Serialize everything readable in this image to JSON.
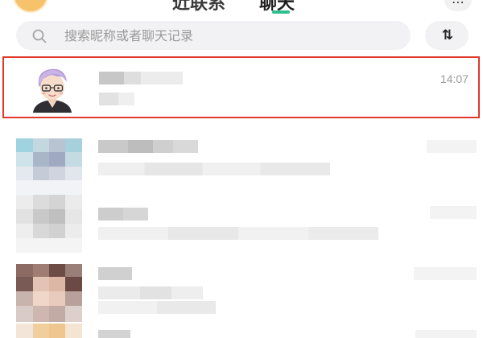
{
  "header": {
    "tabs": [
      {
        "label": "近联系"
      },
      {
        "label": "聊天"
      }
    ],
    "right_button_icon": "more-icon"
  },
  "search": {
    "placeholder": "搜索昵称或者聊天记录",
    "value": "",
    "sort_button_label": "⇅"
  },
  "conversations": [
    {
      "time": "14:07",
      "avatar": "cartoon-avatar-glasses-purple-hair",
      "highlighted": true,
      "highlight_color": "#e1382c"
    },
    {
      "time": "",
      "avatar": "pixelated-avatar"
    },
    {
      "time": "",
      "avatar": "pixelated-avatar"
    },
    {
      "time": "",
      "avatar": "pixelated-avatar"
    },
    {
      "time": "",
      "avatar": "pixelated-avatar"
    }
  ],
  "colors": {
    "accent": "#2fbf8f",
    "highlight_border": "#e1382c",
    "search_bg": "#f2f2f4"
  }
}
